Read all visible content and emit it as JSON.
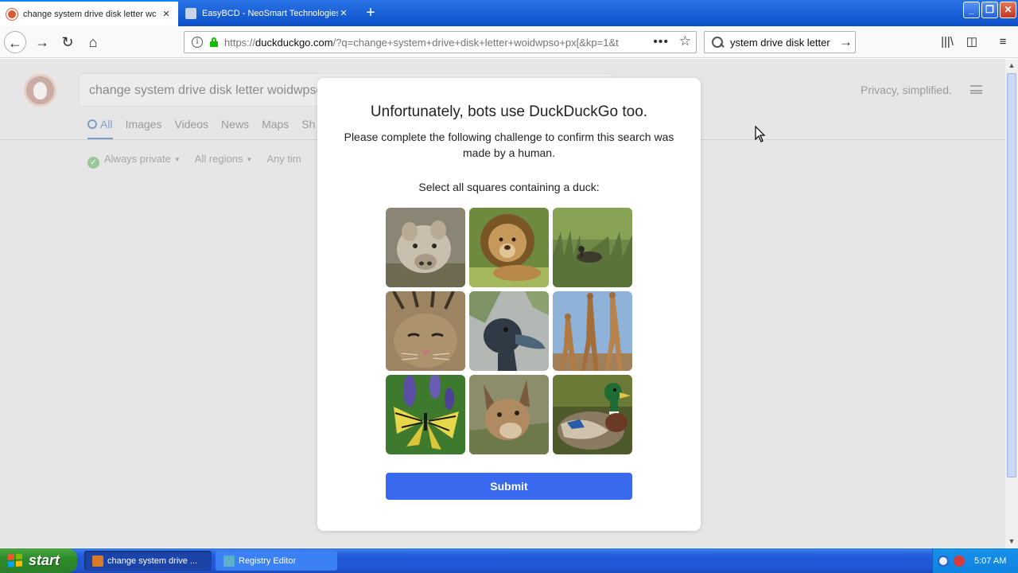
{
  "browser": {
    "tabs": [
      {
        "title": "change system drive disk letter wc",
        "active": true
      },
      {
        "title": "EasyBCD - NeoSmart Technologies",
        "active": false
      }
    ],
    "url_prefix": "https://",
    "url_domain": "duckduckgo.com",
    "url_rest": "/?q=change+system+drive+disk+letter+woidwpso+px[&kp=1&t",
    "search_text": "ystem drive disk letter",
    "window_buttons": [
      "minimize",
      "restore",
      "close"
    ]
  },
  "page": {
    "search_query": "change system drive disk letter woidwpsc",
    "privacy_text": "Privacy, simplified.",
    "tabs": [
      "All",
      "Images",
      "Videos",
      "News",
      "Maps",
      "Sh"
    ],
    "filters": [
      "Always private",
      "All regions",
      "Any tim"
    ]
  },
  "captcha": {
    "title": "Unfortunately, bots use DuckDuckGo too.",
    "subtitle": "Please complete the following challenge to confirm this search was made by a human.",
    "prompt": "Select all squares containing a duck:",
    "tiles": [
      "pig",
      "lion",
      "duck",
      "cat",
      "duck",
      "giraffes",
      "butterfly",
      "caracal",
      "duck"
    ],
    "submit_label": "Submit"
  },
  "taskbar": {
    "start_label": "start",
    "items": [
      {
        "label": "change system drive ...",
        "active": true
      },
      {
        "label": "Registry Editor",
        "active": false
      }
    ],
    "clock": "5:07 AM"
  }
}
